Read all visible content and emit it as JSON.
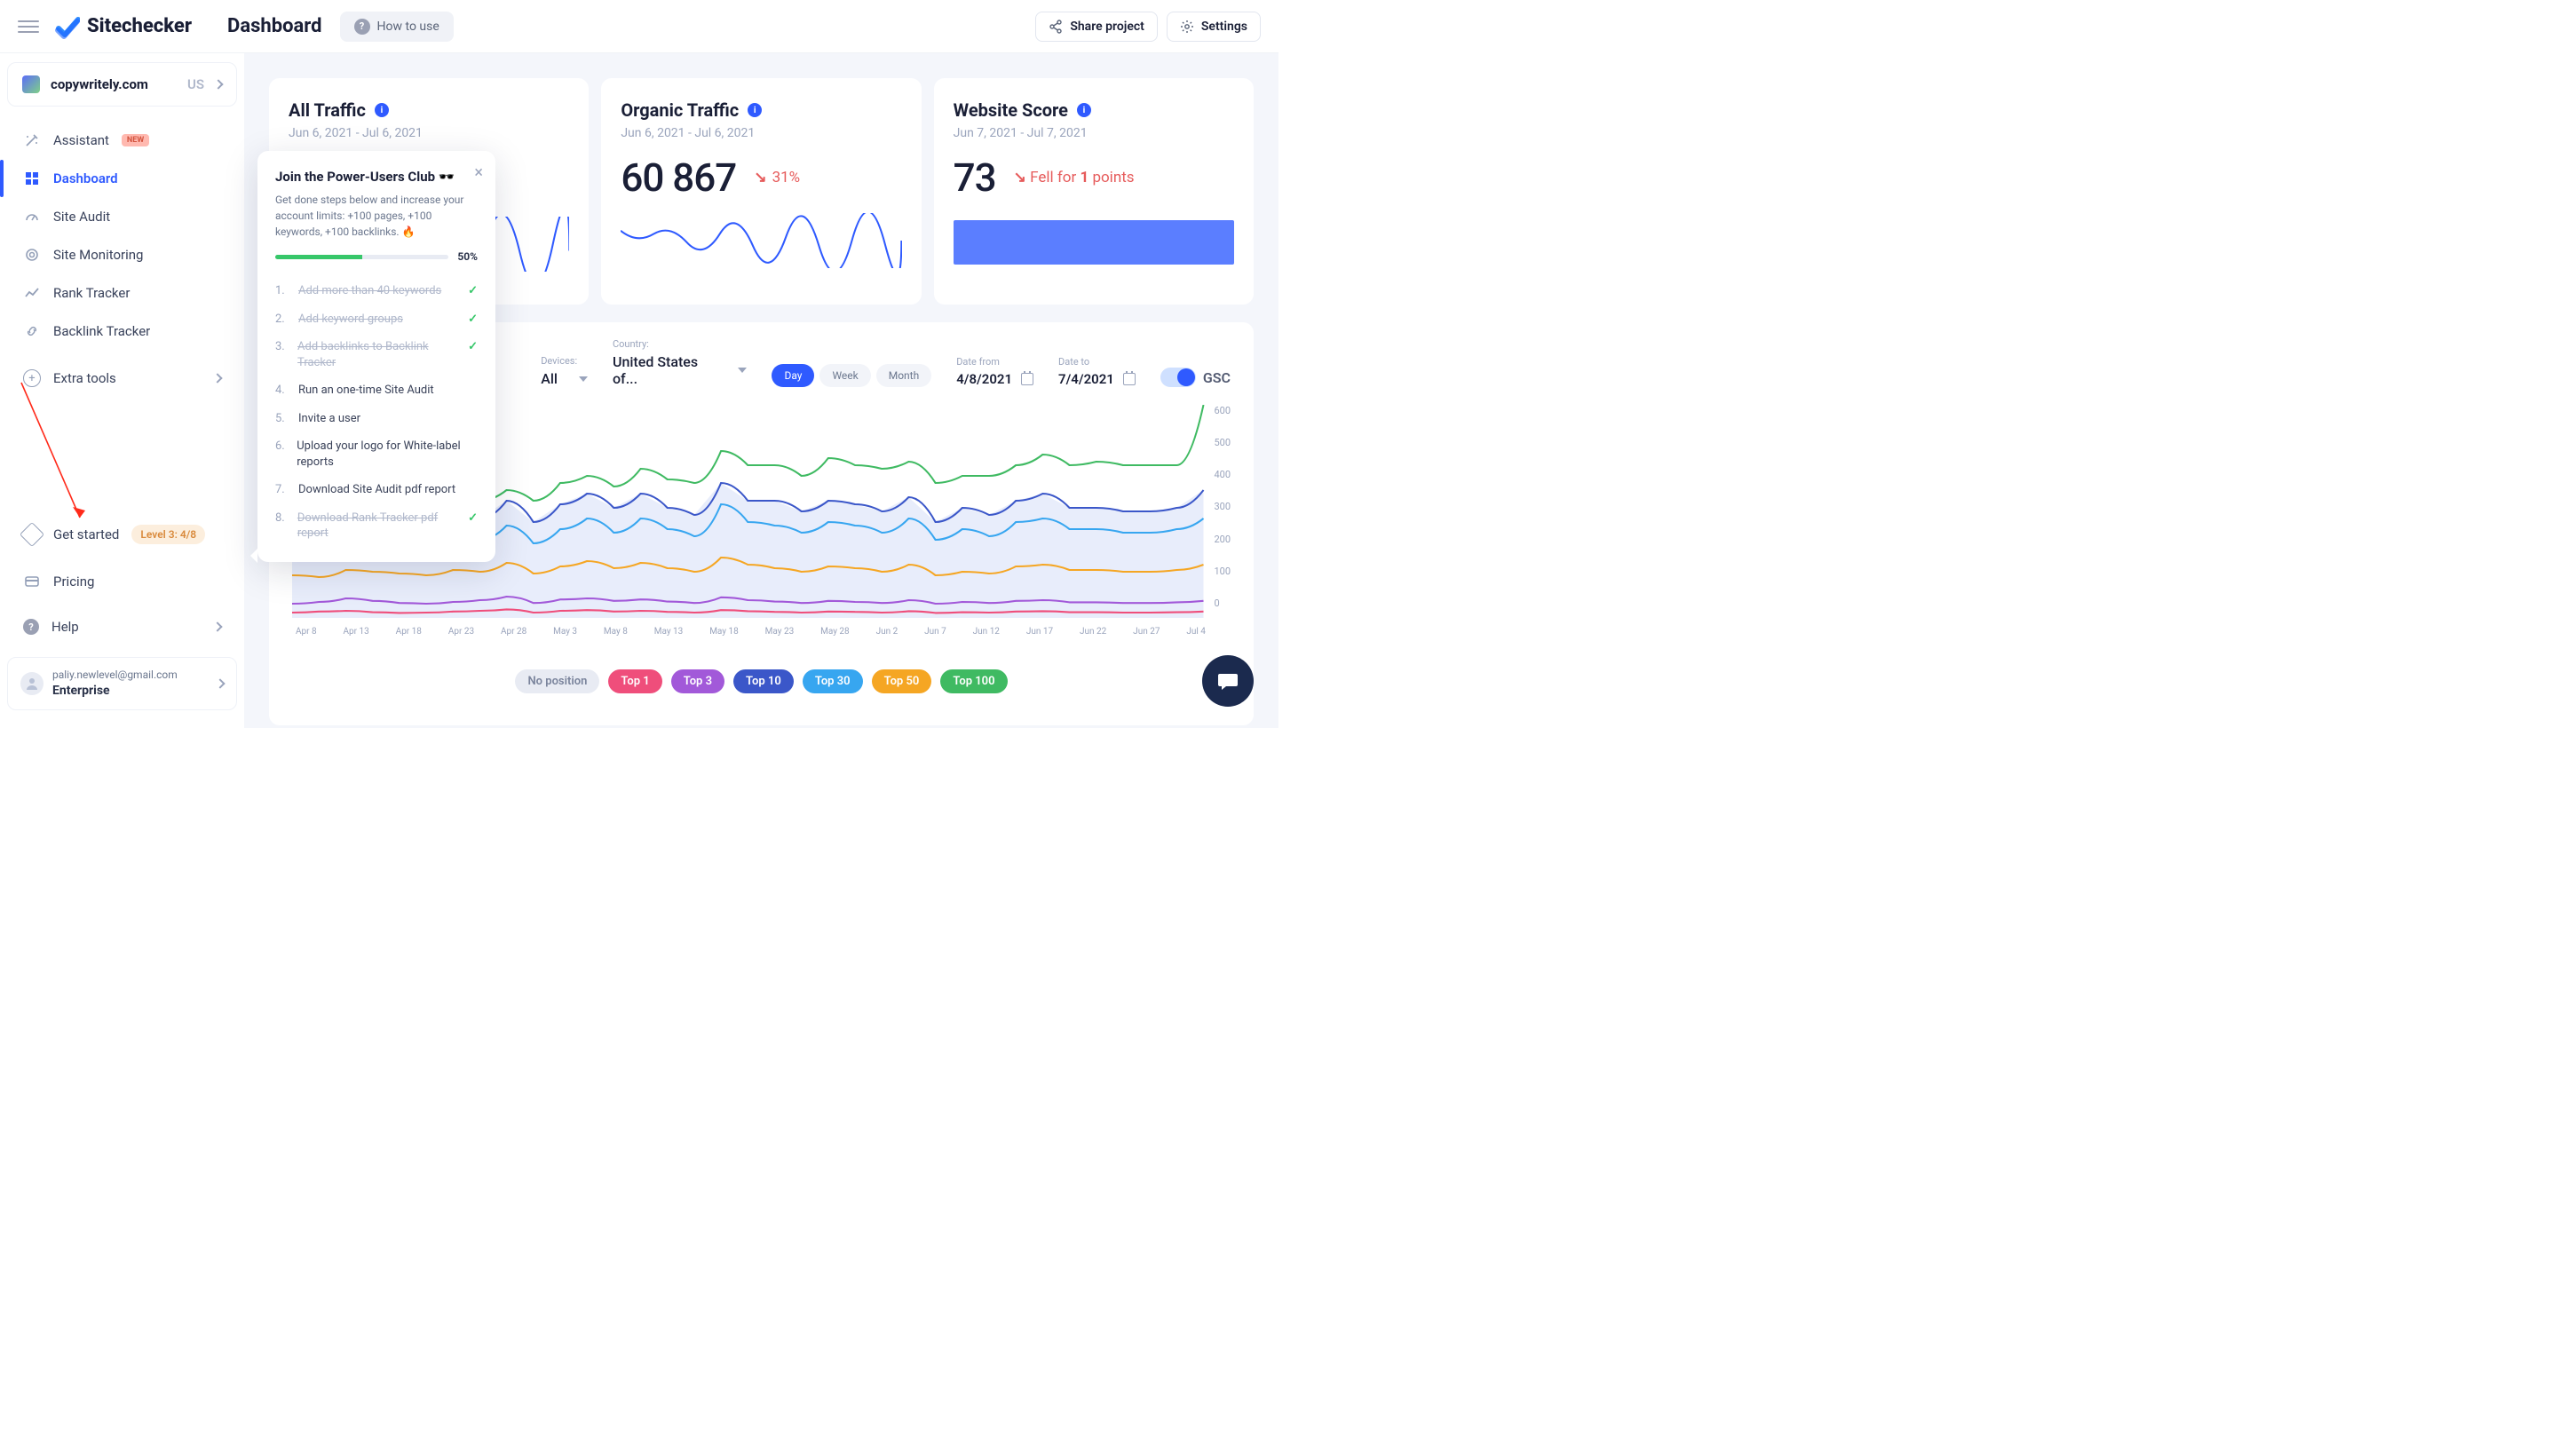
{
  "header": {
    "brand": "Sitechecker",
    "page_title": "Dashboard",
    "howto": "How to use",
    "share": "Share project",
    "settings": "Settings"
  },
  "site": {
    "domain": "copywritely.com",
    "country_code": "US"
  },
  "sidebar": {
    "items": [
      {
        "label": "Assistant",
        "badge": "NEW"
      },
      {
        "label": "Dashboard"
      },
      {
        "label": "Site Audit"
      },
      {
        "label": "Site Monitoring"
      },
      {
        "label": "Rank Tracker"
      },
      {
        "label": "Backlink Tracker"
      }
    ],
    "extra": "Extra tools",
    "get_started": "Get started",
    "level_pill": "Level 3: 4/8",
    "pricing": "Pricing",
    "help": "Help"
  },
  "user": {
    "email": "paliy.newlevel@gmail.com",
    "plan": "Enterprise"
  },
  "cards": {
    "all_traffic": {
      "title": "All Traffic",
      "range": "Jun 6, 2021 - Jul 6, 2021"
    },
    "organic": {
      "title": "Organic Traffic",
      "range": "Jun 6, 2021 - Jul 6, 2021",
      "value": "60 867",
      "delta": "31%"
    },
    "score": {
      "title": "Website Score",
      "range": "Jun 7, 2021 - Jul 7, 2021",
      "value": "73",
      "fell_prefix": "Fell for",
      "fell_n": "1",
      "fell_suffix": "points"
    }
  },
  "filters": {
    "devices_label": "Devices:",
    "devices_value": "All",
    "country_label": "Country:",
    "country_value": "United States of...",
    "seg": [
      "Day",
      "Week",
      "Month"
    ],
    "date_from_label": "Date from",
    "date_from": "4/8/2021",
    "date_to_label": "Date to",
    "date_to": "7/4/2021",
    "gsc": "GSC"
  },
  "chart_data": {
    "type": "line",
    "ylim": [
      0,
      600
    ],
    "y_ticks": [
      600,
      500,
      400,
      300,
      200,
      100,
      0
    ],
    "x_ticks": [
      "Apr 8",
      "Apr 13",
      "Apr 18",
      "Apr 23",
      "Apr 28",
      "May 3",
      "May 8",
      "May 13",
      "May 18",
      "May 23",
      "May 28",
      "Jun 2",
      "Jun 7",
      "Jun 12",
      "Jun 17",
      "Jun 22",
      "Jun 27",
      "Jul 4"
    ],
    "series": [
      {
        "name": "Top 100",
        "color": "#3fba62",
        "values": [
          300,
          310,
          330,
          300,
          320,
          320,
          360,
          330,
          360,
          330,
          380,
          400,
          370,
          420,
          390,
          380,
          470,
          430,
          430,
          400,
          450,
          430,
          420,
          440,
          380,
          400,
          400,
          430,
          460,
          430,
          440,
          430,
          430,
          430,
          600
        ]
      },
      {
        "name": "Top 50",
        "color": "#3b57c9",
        "values": [
          240,
          250,
          290,
          280,
          270,
          260,
          290,
          280,
          330,
          270,
          320,
          350,
          310,
          350,
          310,
          290,
          380,
          330,
          330,
          300,
          330,
          320,
          300,
          340,
          270,
          310,
          290,
          330,
          350,
          310,
          310,
          300,
          300,
          310,
          360
        ]
      },
      {
        "name": "Top 30",
        "color": "#37a6f0",
        "values": [
          200,
          190,
          230,
          220,
          210,
          200,
          220,
          220,
          260,
          210,
          250,
          280,
          240,
          280,
          250,
          230,
          320,
          270,
          260,
          240,
          270,
          260,
          240,
          280,
          220,
          250,
          230,
          270,
          280,
          250,
          250,
          240,
          240,
          250,
          280
        ]
      },
      {
        "name": "Top 10",
        "color": "#f5a623",
        "values": [
          120,
          115,
          135,
          130,
          125,
          120,
          135,
          130,
          155,
          125,
          145,
          160,
          140,
          155,
          140,
          130,
          170,
          150,
          140,
          130,
          145,
          140,
          130,
          150,
          120,
          130,
          125,
          145,
          150,
          135,
          135,
          130,
          130,
          135,
          150
        ]
      },
      {
        "name": "Top 3",
        "color": "#a259d9",
        "values": [
          40,
          45,
          55,
          48,
          42,
          40,
          45,
          50,
          60,
          42,
          52,
          55,
          48,
          52,
          46,
          42,
          58,
          50,
          46,
          42,
          48,
          45,
          42,
          50,
          40,
          45,
          42,
          48,
          50,
          44,
          44,
          42,
          42,
          44,
          48
        ]
      },
      {
        "name": "Top 1",
        "color": "#ef4e7b",
        "values": [
          15,
          18,
          20,
          16,
          14,
          15,
          18,
          20,
          24,
          15,
          20,
          22,
          18,
          20,
          17,
          15,
          22,
          19,
          17,
          15,
          18,
          17,
          15,
          19,
          14,
          16,
          15,
          18,
          19,
          16,
          16,
          15,
          15,
          16,
          18
        ]
      }
    ]
  },
  "legend": [
    "No position",
    "Top 1",
    "Top 3",
    "Top 10",
    "Top 30",
    "Top 50",
    "Top 100"
  ],
  "popup": {
    "title": "Join the Power-Users Club 🕶️",
    "sub": "Get done steps below and increase your account limits: +100 pages, +100 keywords, +100 backlinks. 🔥",
    "pct": "50%",
    "steps": [
      {
        "n": "1.",
        "txt": "Add more than 40 keywords",
        "done": true
      },
      {
        "n": "2.",
        "txt": "Add keyword groups",
        "done": true
      },
      {
        "n": "3.",
        "txt": "Add backlinks to Backlink Tracker",
        "done": true
      },
      {
        "n": "4.",
        "txt": "Run an one-time Site Audit",
        "done": false
      },
      {
        "n": "5.",
        "txt": "Invite a user",
        "done": false
      },
      {
        "n": "6.",
        "txt": "Upload your logo for White-label reports",
        "done": false
      },
      {
        "n": "7.",
        "txt": "Download Site Audit pdf report",
        "done": false
      },
      {
        "n": "8.",
        "txt": "Download Rank Tracker pdf report",
        "done": true
      }
    ]
  }
}
